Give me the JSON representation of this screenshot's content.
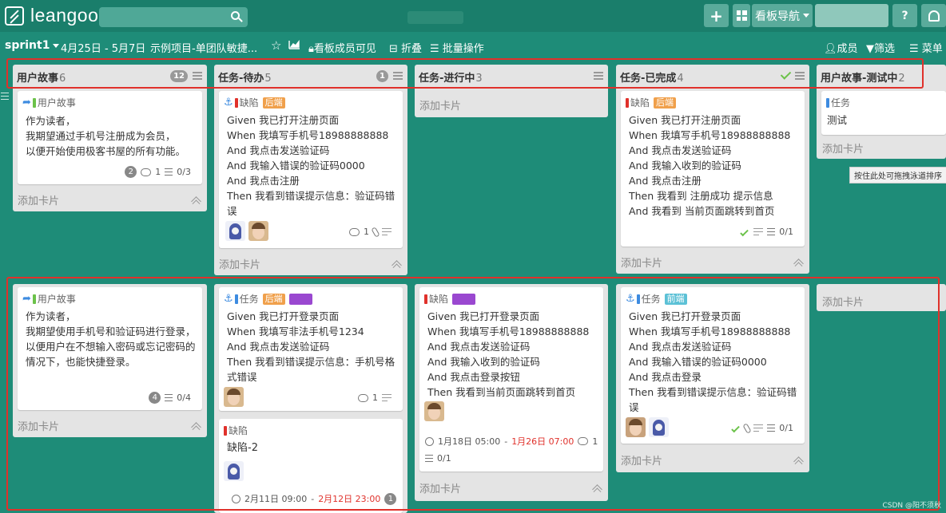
{
  "topbar": {
    "logo_text": "leangoo",
    "plus": "+",
    "nav_label": "看板导航",
    "help": "?"
  },
  "board_header": {
    "sprint": "sprint1",
    "dates": "4月25日 - 5月7日",
    "project": "示例项目-单团队敏捷...",
    "star": "☆",
    "visibility": "看板成员可见",
    "fold": "折叠",
    "batch": "批量操作",
    "members": "成员",
    "filter": "筛选",
    "menu": "菜单"
  },
  "lists": [
    {
      "title": "用户故事",
      "count": "6",
      "badge": "12"
    },
    {
      "title": "任务-待办",
      "count": "5",
      "badge": "1"
    },
    {
      "title": "任务-进行中",
      "count": "3",
      "badge": ""
    },
    {
      "title": "任务-已完成",
      "count": "4",
      "badge": ""
    },
    {
      "title": "用户故事-测试中",
      "count": "2",
      "badge": ""
    }
  ],
  "add_card": "添加卡片",
  "cards": {
    "story1": {
      "type": "用户故事",
      "text": "作为读者，\n我期望通过手机号注册成为会员，\n以便开始使用极客书屋的所有功能。",
      "points": "2",
      "comments": "1",
      "checklist": "0/3"
    },
    "todo1": {
      "type": "缺陷",
      "tag": "后端",
      "text": "Given 我已打开注册页面\nWhen 我填写手机号18988888888\nAnd 我点击发送验证码\nAnd 我输入错误的验证码0000\nAnd 我点击注册\nThen 我看到错误提示信息：验证码错误",
      "comments": "1"
    },
    "done1": {
      "type": "缺陷",
      "tag": "后端",
      "text": "Given 我已打开注册页面\nWhen 我填写手机号18988888888\nAnd 我点击发送验证码\nAnd 我输入收到的验证码\nAnd 我点击注册\nThen 我看到 注册成功 提示信息\nAnd 我看到 当前页面跳转到首页",
      "checklist": "0/1"
    },
    "test1": {
      "type": "任务",
      "text": "测试"
    },
    "story2": {
      "type": "用户故事",
      "text": "作为读者，\n我期望使用手机号和验证码进行登录，\n以便用户在不想输入密码或忘记密码的情况下，也能快捷登录。",
      "points": "4",
      "checklist": "0/4"
    },
    "todo2": {
      "type": "任务",
      "tag": "后端",
      "text": "Given 我已打开登录页面\nWhen 我填写非法手机号1234\nAnd 我点击发送验证码\nThen 我看到错误提示信息：手机号格式错误",
      "comments": "1"
    },
    "todo3": {
      "type": "缺陷",
      "text": "缺陷-2",
      "date_start": "2月11日 09:00",
      "date_sep": "-",
      "date_end": "2月12日 23:00",
      "badge": "1"
    },
    "prog1": {
      "type": "缺陷",
      "text": "Given 我已打开登录页面\nWhen 我填写手机号18988888888\nAnd 我点击发送验证码\nAnd 我输入收到的验证码\nAnd 我点击登录按钮\nThen 我看到当前页面跳转到首页",
      "date_start": "1月18日 05:00",
      "date_sep": "-",
      "date_end": "1月26日 07:00",
      "comments": "1",
      "checklist": "0/1"
    },
    "done2": {
      "type": "任务",
      "tag": "前端",
      "text": "Given 我已打开登录页面\nWhen 我填写手机号18988888888\nAnd 我点击发送验证码\nAnd 我输入错误的验证码0000\nAnd 我点击登录\nThen 我看到错误提示信息：验证码错误",
      "checklist": "0/1"
    }
  },
  "tooltip": "按住此处可拖拽泳道排序",
  "watermark": "CSDN @阳不须秋",
  "colors": {
    "background": "#1e8c78",
    "highlight": "#e0312b",
    "tag_backend": "#f0a04b",
    "tag_frontend": "#5cc1d6",
    "tag_purple": "#9a48d0"
  }
}
